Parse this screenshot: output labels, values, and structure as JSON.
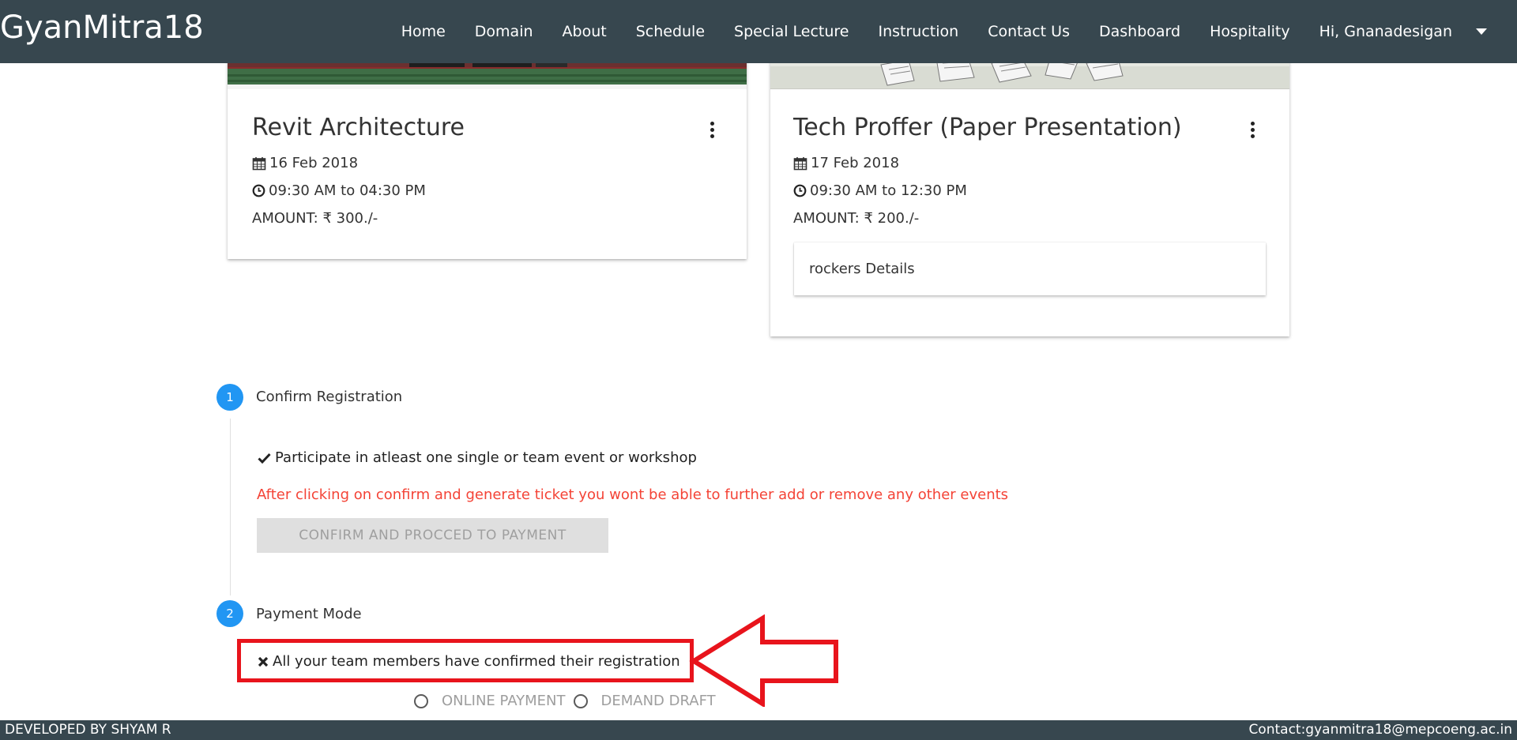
{
  "brand": "GyanMitra18",
  "nav": {
    "items": [
      "Home",
      "Domain",
      "About",
      "Schedule",
      "Special Lecture",
      "Instruction",
      "Contact Us",
      "Dashboard",
      "Hospitality"
    ],
    "user": "Hi, Gnanadesigan"
  },
  "cards": [
    {
      "title": "Revit Architecture",
      "date": "16 Feb 2018",
      "time": "09:30 AM to 04:30 PM",
      "amount": "AMOUNT: ₹ 300./-"
    },
    {
      "title": "Tech Proffer (Paper Presentation)",
      "date": "17 Feb 2018",
      "time": "09:30 AM to 12:30 PM",
      "amount": "AMOUNT: ₹ 200./-",
      "details": "rockers Details"
    }
  ],
  "steps": [
    {
      "number": "1",
      "title": "Confirm Registration",
      "check": "Participate in atleast one single or team event or workshop",
      "warning": "After clicking on confirm and generate ticket you wont be able to further add or remove any other events",
      "button": "CONFIRM AND PROCCED TO PAYMENT"
    },
    {
      "number": "2",
      "title": "Payment Mode",
      "cross": "All your team members have confirmed their registration",
      "options": [
        "ONLINE PAYMENT",
        "DEMAND DRAFT"
      ]
    }
  ],
  "colors": {
    "header": "#37474f",
    "accent": "#2196f3",
    "warning": "#f44336",
    "annotation": "#e8141c"
  },
  "footer": {
    "left": "DEVELOPED BY SHYAM R",
    "right": "Contact:gyanmitra18@mepcoeng.ac.in"
  }
}
